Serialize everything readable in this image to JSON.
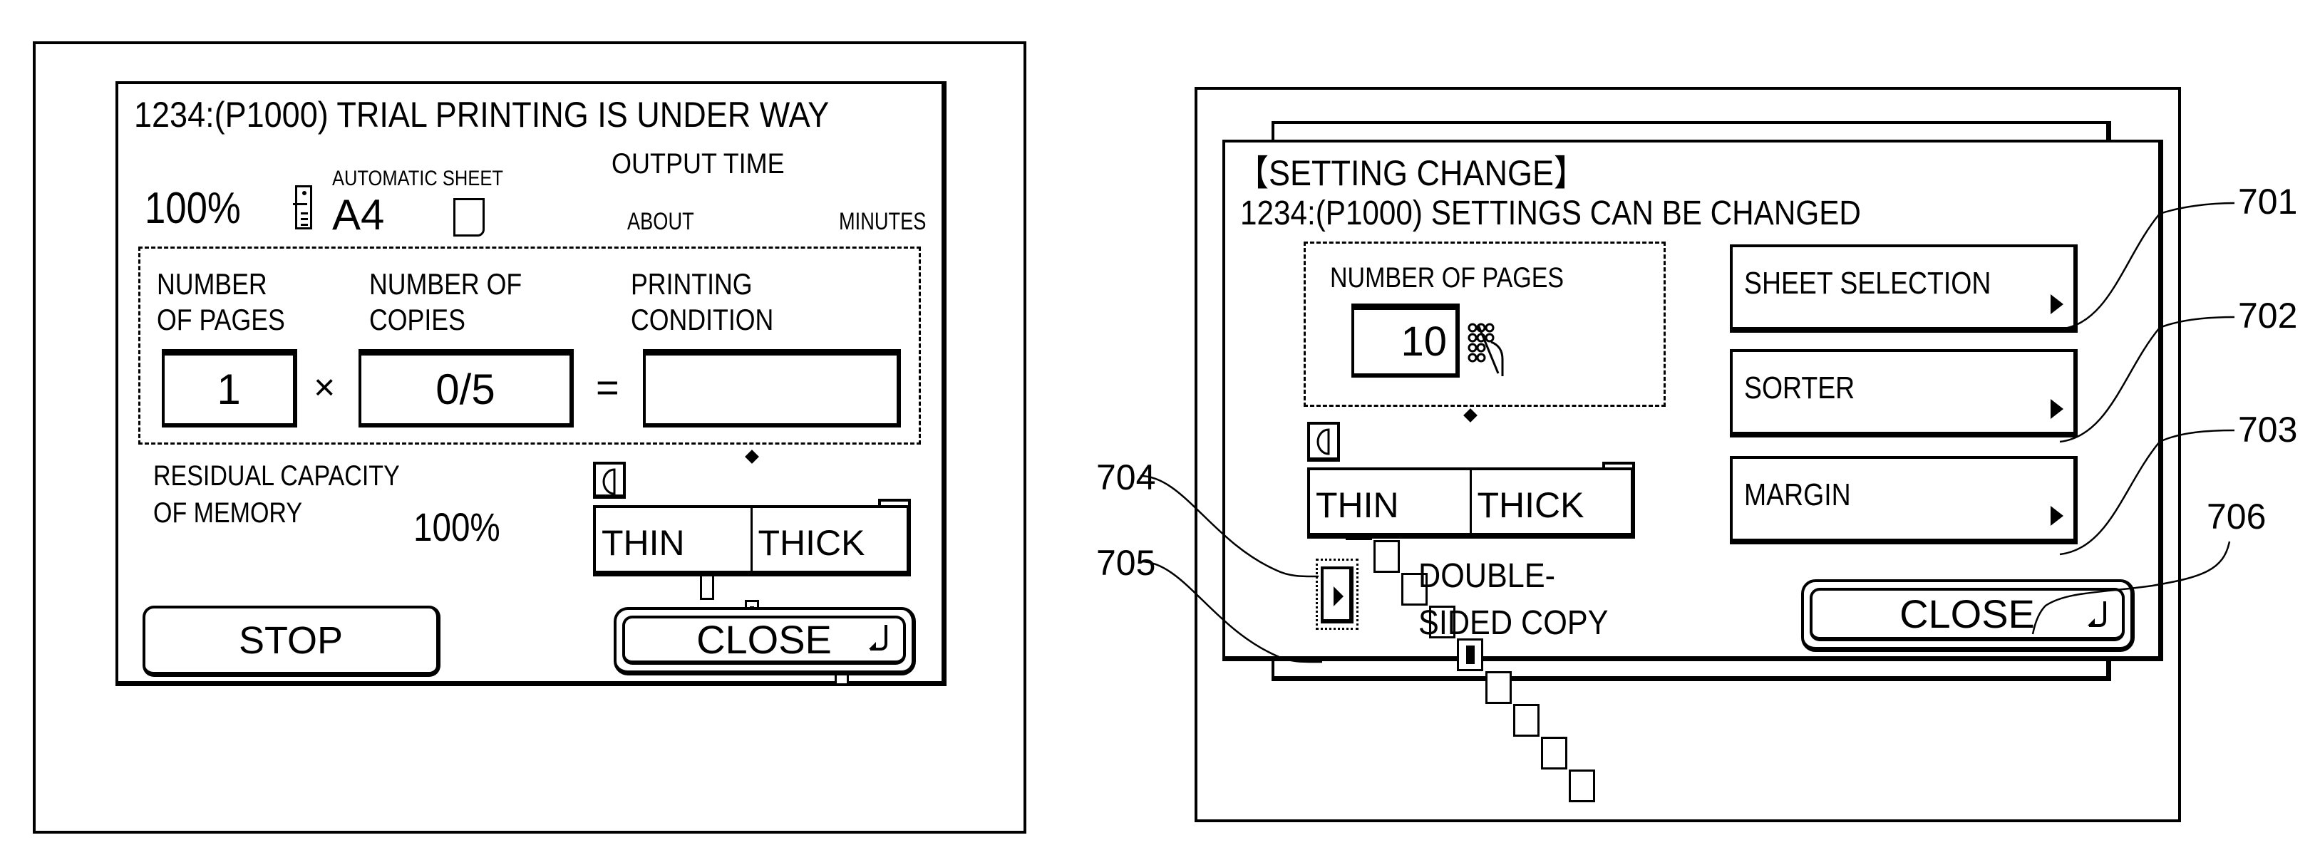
{
  "left_screen": {
    "status_line": "1234:(P1000) TRIAL PRINTING IS UNDER WAY",
    "zoom_ratio": "100%",
    "sheet_mode_label": "AUTOMATIC SHEET",
    "sheet_size": "A4",
    "output_time_label": "OUTPUT TIME",
    "about_label": "ABOUT",
    "minutes_label": "MINUTES",
    "pages_label_1": "NUMBER",
    "pages_label_2": "OF PAGES",
    "copies_label_1": "NUMBER OF",
    "copies_label_2": "COPIES",
    "condition_label_1": "PRINTING",
    "condition_label_2": "CONDITION",
    "pages_value": "1",
    "multiply_sign": "×",
    "copies_value": "0/5",
    "equals_sign": "=",
    "condition_value": "",
    "memory_label_1": "RESIDUAL CAPACITY",
    "memory_label_2": "OF MEMORY",
    "memory_value": "100%",
    "density": {
      "levels": 5,
      "selected": 3
    },
    "thin_label": "THIN",
    "thick_label": "THICK",
    "stop_label": "STOP",
    "close_label": "CLOSE"
  },
  "right_screen": {
    "title": "【SETTING CHANGE】",
    "status_line": "1234:(P1000) SETTINGS CAN BE CHANGED",
    "pages_label": "NUMBER OF PAGES",
    "pages_value": "10",
    "density": {
      "levels": 9,
      "selected": 5
    },
    "thin_label": "THIN",
    "thick_label": "THICK",
    "double_sided_label_1": "DOUBLE-",
    "double_sided_label_2": "SIDED COPY",
    "menu_buttons": [
      {
        "label": "SHEET SELECTION",
        "ref": "701"
      },
      {
        "label": "SORTER",
        "ref": "702"
      },
      {
        "label": "MARGIN",
        "ref": "703"
      }
    ],
    "close_label": "CLOSE",
    "refs": {
      "thin_thick": "704",
      "double_sided": "705",
      "close": "706"
    }
  }
}
